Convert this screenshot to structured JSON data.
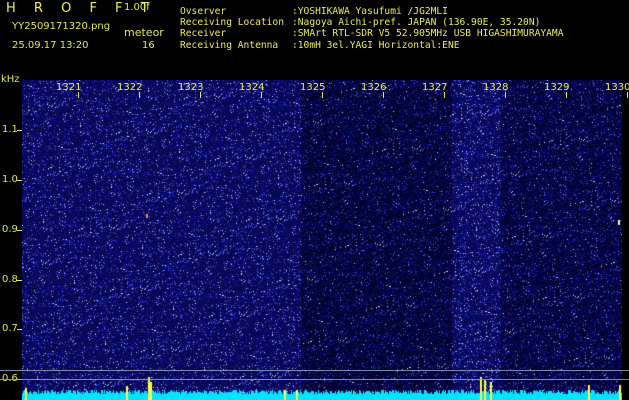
{
  "header": {
    "brand": "H R O F F T",
    "version": "1.00f",
    "filename": "YY2509171320.png",
    "event_label": "meteor",
    "datetime": "25.09.17 13:20",
    "event_count": "16"
  },
  "info": [
    {
      "key": "Ovserver",
      "value": ":YOSHIKAWA Yasufumi /JG2MLI"
    },
    {
      "key": "Receiving Location",
      "value": ":Nagoya Aichi-pref. JAPAN (136.90E, 35.20N)"
    },
    {
      "key": "Receiver",
      "value": ":SMArt RTL-SDR V5 52.905MHz USB HIGASHIMURAYAMA"
    },
    {
      "key": "Receiving Antenna",
      "value": ":10mH 3el.YAGI Horizontal:ENE"
    }
  ],
  "axis": {
    "y_unit": "kHz",
    "y_labels": [
      "1.1",
      "1.0",
      "0.9",
      "0.8",
      "0.7",
      "0.6"
    ],
    "x_labels": [
      "1321",
      "1322",
      "1323",
      "1324",
      "1325",
      "1326",
      "1327",
      "1328",
      "1329",
      "1330"
    ]
  },
  "colors": {
    "text": "#e8e84a",
    "background": "#000000",
    "spectrum_bg": "#0a0a6e",
    "baseline": "#00e5ff",
    "meteor": "#ffff40"
  }
}
